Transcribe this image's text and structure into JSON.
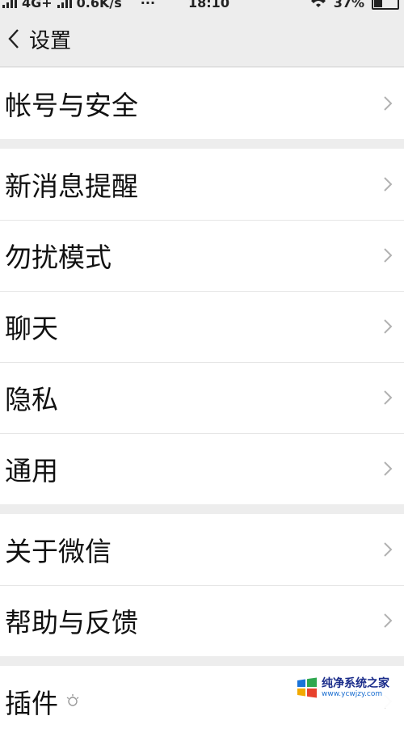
{
  "status_bar": {
    "network": "4G+",
    "speed": "0.6K/s",
    "more": "···",
    "time": "18:10",
    "battery": "37%",
    "battery_level": 0.37
  },
  "header": {
    "title": "设置"
  },
  "groups": [
    {
      "items": [
        {
          "label": "帐号与安全"
        }
      ]
    },
    {
      "items": [
        {
          "label": "新消息提醒"
        },
        {
          "label": "勿扰模式"
        },
        {
          "label": "聊天"
        },
        {
          "label": "隐私"
        },
        {
          "label": "通用"
        }
      ]
    },
    {
      "items": [
        {
          "label": "关于微信"
        },
        {
          "label": "帮助与反馈"
        }
      ]
    },
    {
      "items": [
        {
          "label": "插件"
        }
      ]
    }
  ],
  "watermark": {
    "name": "纯净系统之家",
    "url": "www.ycwjzy.com"
  },
  "colors": {
    "background": "#ededed",
    "card": "#ffffff",
    "text": "#111111",
    "chevron": "#b2b2b2"
  },
  "icons": [
    "back-arrow-icon",
    "chevron-right-icon",
    "signal-icon",
    "wifi-icon",
    "battery-icon",
    "plugin-bulb-icon"
  ]
}
